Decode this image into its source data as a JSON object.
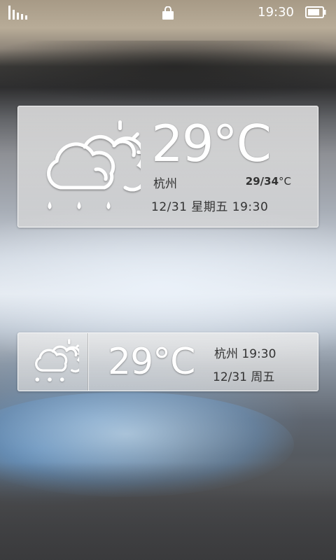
{
  "status_bar": {
    "time": "19:30",
    "signal_icon": "signal-bars-icon",
    "store_icon": "shopping-bag-icon",
    "battery_icon": "battery-icon"
  },
  "widget_large": {
    "temperature": "29°C",
    "city": "杭州",
    "range_low_high": "29/34",
    "range_unit": "°C",
    "date_time": "12/31 星期五 19:30",
    "icon": "cloudy-sun-rain-icon"
  },
  "widget_small": {
    "temperature": "29°C",
    "city_time": "杭州 19:30",
    "date": "12/31 周五",
    "icon": "cloudy-sun-rain-icon"
  },
  "colors": {
    "panel": "#dcdcdc",
    "text_dark": "#333333",
    "temp_text": "#ffffff"
  }
}
